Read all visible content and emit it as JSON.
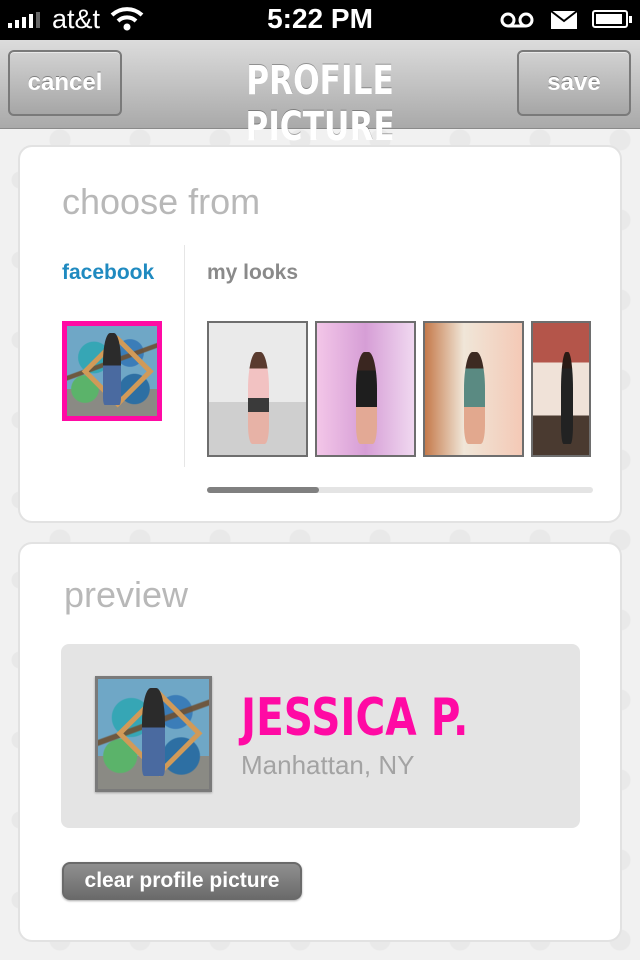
{
  "status_bar": {
    "carrier": "at&t",
    "time": "5:22 PM"
  },
  "nav": {
    "cancel_label": "cancel",
    "title": "PROFILE PICTURE",
    "save_label": "save"
  },
  "choose": {
    "title": "choose from",
    "tabs": [
      {
        "label": "facebook",
        "active": true
      },
      {
        "label": "my looks",
        "active": false
      }
    ],
    "looks_count_visible": 4
  },
  "preview": {
    "title": "preview",
    "name": "JESSICA P.",
    "location": "Manhattan, NY",
    "clear_label": "clear profile picture"
  },
  "colors": {
    "accent": "#ff0aa4",
    "facebook_blue": "#1f8ac0"
  }
}
